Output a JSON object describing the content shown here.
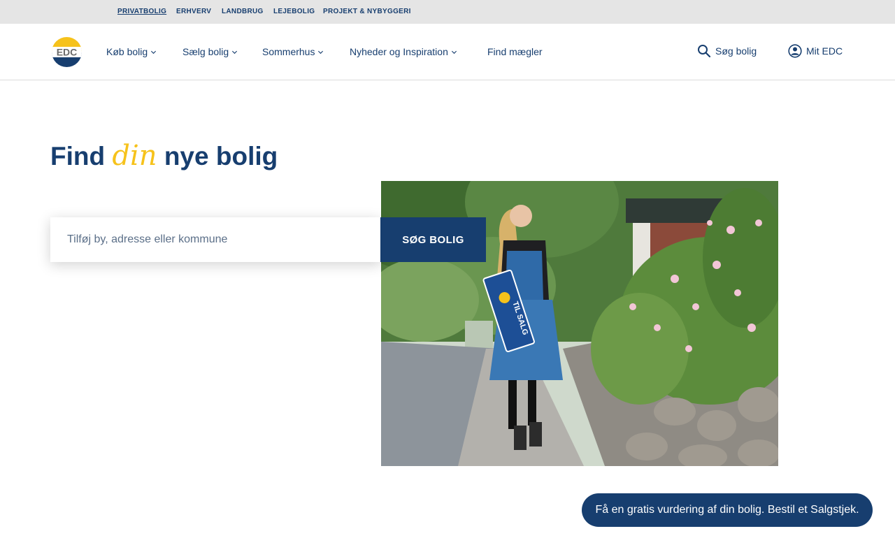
{
  "topbar": {
    "segments": [
      "PRIVATBOLIG",
      "ERHVERV",
      "LANDBRUG",
      "LEJEBOLIG",
      "PROJEKT & NYBYGGERI"
    ],
    "active": "PRIVATBOLIG"
  },
  "header": {
    "logo_text": "EDC",
    "nav": [
      "Køb bolig",
      "Sælg bolig",
      "Sommerhus",
      "Nyheder og Inspiration",
      "Find mægler"
    ],
    "search_link": "Søg bolig",
    "account_link": "Mit EDC"
  },
  "hero": {
    "title_prefix": "Find",
    "title_accent": "din",
    "title_suffix": "nye bolig",
    "search_placeholder": "Tilføj by, adresse eller kommune",
    "search_button": "SØG BOLIG",
    "image_sign_text": "TIL SALG"
  },
  "cta": {
    "label": "Få en gratis vurdering af din bolig. Bestil et Salgstjek."
  },
  "colors": {
    "brand_navy": "#173e6f",
    "brand_yellow": "#f6c21b",
    "topbar_bg": "#e5e5e5"
  }
}
